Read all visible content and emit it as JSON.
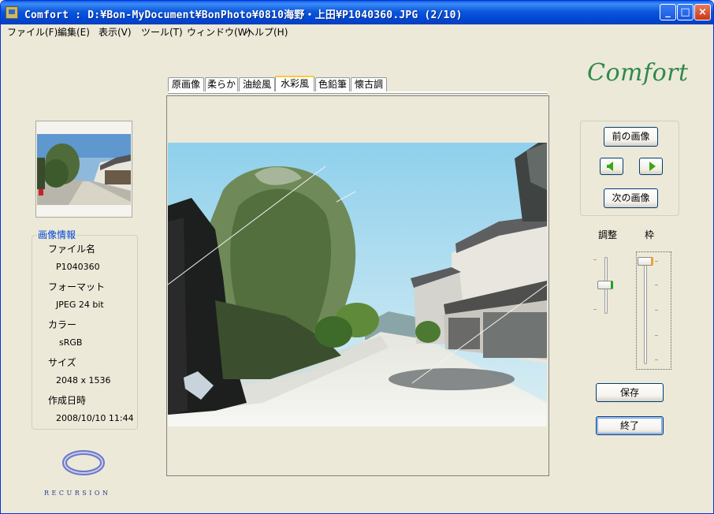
{
  "window": {
    "title": "Comfort : D:¥Bon-MyDocument¥BonPhoto¥0810海野・上田¥P1040360.JPG (2/10)",
    "minimize_label": "_",
    "maximize_label": "□",
    "close_label": "×"
  },
  "menu": {
    "items": [
      "ファイル(F)",
      "編集(E)",
      "表示(V)",
      "ツール(T)",
      "ウィンドウ(W)",
      "ヘルプ(H)"
    ]
  },
  "brand": {
    "logo_text": "Comfort"
  },
  "tabs": {
    "items": [
      "原画像",
      "柔らか",
      "油絵風",
      "水彩風",
      "色鉛筆",
      "懐古調"
    ],
    "active_index": 3
  },
  "image_info": {
    "title": "画像情報",
    "file_name_label": "ファイル名",
    "file_name": "P1040360",
    "format_label": "フォーマット",
    "format": "JPEG  24 bit",
    "color_label": "カラー",
    "color": "sRGB",
    "size_label": "サイズ",
    "size": "2048 x 1536",
    "date_label": "作成日時",
    "date": "2008/10/10 11:44"
  },
  "company": {
    "name": "RECURSION"
  },
  "navigation": {
    "prev_label": "前の画像",
    "next_label": "次の画像"
  },
  "sliders": {
    "adjust_label": "調整",
    "frame_label": "枠"
  },
  "actions": {
    "save_label": "保存",
    "exit_label": "終了"
  },
  "colors": {
    "titlebar": "#0054e3",
    "window_bg": "#ece9d8",
    "logo_green": "#2e8a4a",
    "info_title_blue": "#0046d5",
    "arrow_green": "#3aa61a"
  }
}
